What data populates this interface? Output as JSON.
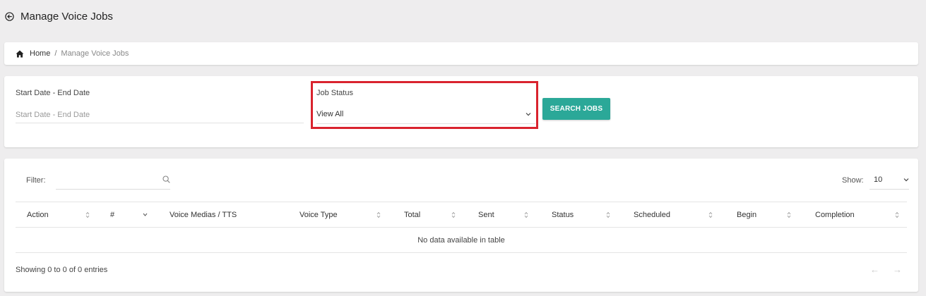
{
  "page": {
    "title": "Manage Voice Jobs",
    "back_icon": "arrow-left-circle-icon"
  },
  "breadcrumb": {
    "home_icon": "home-icon",
    "home": "Home",
    "separator": "/",
    "current": "Manage Voice Jobs"
  },
  "search": {
    "date_label": "Start Date - End Date",
    "date_placeholder": "Start Date - End Date",
    "status_label": "Job Status",
    "status_value": "View All",
    "button": "SEARCH JOBS",
    "button_color": "#2ba898",
    "highlight_color": "#d9232e"
  },
  "table": {
    "filter_label": "Filter:",
    "filter_value": "",
    "show_label": "Show:",
    "show_value": "10",
    "columns": [
      "Action",
      "#",
      "Voice Medias / TTS",
      "Voice Type",
      "Total",
      "Sent",
      "Status",
      "Scheduled",
      "Begin",
      "Completion"
    ],
    "empty_message": "No data available in table",
    "info": "Showing 0 to 0 of 0 entries",
    "prev_icon": "arrow-left-icon",
    "next_icon": "arrow-right-icon"
  }
}
